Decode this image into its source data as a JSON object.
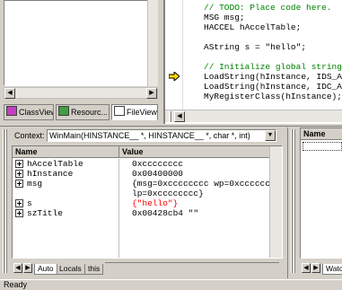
{
  "workspace": {
    "tabs": [
      {
        "label": "ClassView"
      },
      {
        "label": "Resourc..."
      },
      {
        "label": "FileView"
      }
    ]
  },
  "editor": {
    "lines": [
      {
        "text": "// TODO: Place code here.",
        "type": "comment"
      },
      {
        "text": "MSG msg;",
        "type": "code"
      },
      {
        "text": "HACCEL hAccelTable;",
        "type": "code"
      },
      {
        "text": "",
        "type": "code"
      },
      {
        "text": "AString s = \"hello\";",
        "type": "code"
      },
      {
        "text": "",
        "type": "code"
      },
      {
        "text": "// Initialize global strings",
        "type": "comment"
      },
      {
        "text": "LoadString(hInstance, IDS_APP_",
        "type": "code"
      },
      {
        "text": "LoadString(hInstance, IDC_AUTO",
        "type": "code"
      },
      {
        "text": "MyRegisterClass(hInstance);",
        "type": "code"
      }
    ]
  },
  "variables": {
    "context_label": "Context:",
    "context_value": "WinMain(HINSTANCE__ *, HINSTANCE__ *, char *, int)",
    "columns": {
      "name": "Name",
      "value": "Value"
    },
    "rows": [
      {
        "name": "hAccelTable",
        "value": "0xcccccccc",
        "value2": "",
        "changed": false
      },
      {
        "name": "hInstance",
        "value": "0x00400000",
        "value2": "",
        "changed": false
      },
      {
        "name": "msg",
        "value": "{msg=0xcccccccc wp=0xcccccccc",
        "value2": "lp=0xcccccccc}",
        "changed": false
      },
      {
        "name": "s",
        "value": "{\"hello\"}",
        "value2": "",
        "changed": true
      },
      {
        "name": "szTitle",
        "value": "0x00428cb4 \"\"",
        "value2": "",
        "changed": false
      }
    ],
    "tabs": [
      {
        "label": "Auto"
      },
      {
        "label": "Locals"
      },
      {
        "label": "this"
      }
    ]
  },
  "watch": {
    "column_name": "Name",
    "tab_label": "Watc"
  },
  "statusbar": {
    "text": "Ready"
  },
  "colors": {
    "comment": "#008000",
    "changed_value": "#ff0000",
    "breakpoint_arrow": "#ffd800"
  }
}
